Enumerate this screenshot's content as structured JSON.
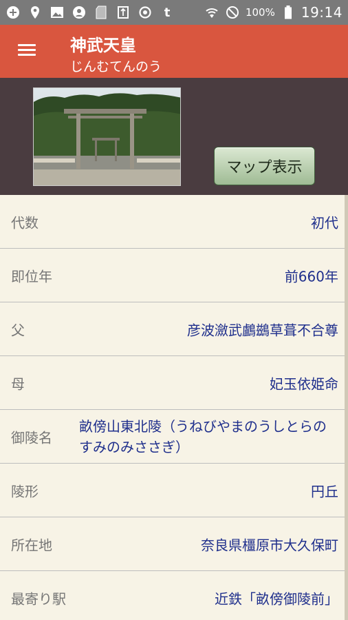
{
  "status": {
    "battery": "100%",
    "time": "19:14",
    "left_icons": [
      "add-circle-icon",
      "location-pin-icon",
      "image-icon",
      "refresh-user-icon",
      "sd-card-icon",
      "usb-icon",
      "sync-icon",
      "tumblr-icon"
    ],
    "right_icons": [
      "wifi-icon",
      "do-not-disturb-icon",
      "battery-icon"
    ]
  },
  "appbar": {
    "title": "神武天皇",
    "subtitle": "じんむてんのう"
  },
  "hero": {
    "map_button": "マップ表示"
  },
  "details": [
    {
      "label": "代数",
      "value": "初代"
    },
    {
      "label": "即位年",
      "value": "前660年"
    },
    {
      "label": "父",
      "value": "彦波瀲武鸕鷀草葺不合尊"
    },
    {
      "label": "母",
      "value": "妃玉依姫命"
    },
    {
      "label": "御陵名",
      "value": "畝傍山東北陵（うねびやまのうしとらのすみのみささぎ）"
    },
    {
      "label": "陵形",
      "value": "円丘"
    },
    {
      "label": "所在地",
      "value": "奈良県橿原市大久保町"
    },
    {
      "label": "最寄り駅",
      "value": "近鉄「畝傍御陵前」"
    }
  ]
}
